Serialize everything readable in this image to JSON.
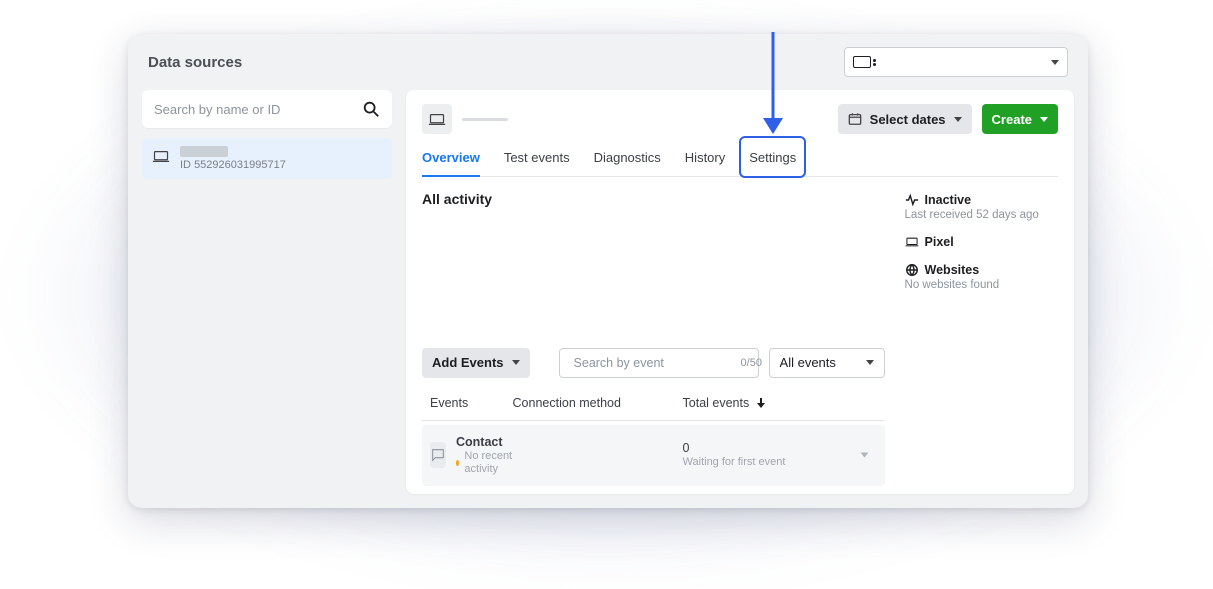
{
  "page": {
    "title": "Data sources"
  },
  "topbar": {
    "selected_account": ""
  },
  "sidebar": {
    "search_placeholder": "Search by name or ID",
    "items": [
      {
        "id_label": "ID",
        "id_value": "552926031995717"
      }
    ]
  },
  "main_header": {
    "select_dates_label": "Select dates",
    "create_label": "Create"
  },
  "tabs": [
    {
      "key": "overview",
      "label": "Overview",
      "active": true
    },
    {
      "key": "test_events",
      "label": "Test events",
      "active": false
    },
    {
      "key": "diagnostics",
      "label": "Diagnostics",
      "active": false
    },
    {
      "key": "history",
      "label": "History",
      "active": false
    },
    {
      "key": "settings",
      "label": "Settings",
      "active": false
    }
  ],
  "annotation": {
    "highlighted_tab": "settings"
  },
  "overview": {
    "heading": "All activity",
    "status": {
      "inactive_label": "Inactive",
      "last_received": "Last received 52 days ago",
      "pixel_label": "Pixel",
      "websites_label": "Websites",
      "websites_sub": "No websites found"
    },
    "events_toolbar": {
      "add_events_label": "Add Events",
      "search_placeholder": "Search by event",
      "counter": "0/50",
      "filter_label": "All events"
    },
    "columns": {
      "events": "Events",
      "connection_method": "Connection method",
      "total_events": "Total events"
    },
    "rows": [
      {
        "name": "Contact",
        "subtext": "No recent activity",
        "connection_method": "",
        "total_value": "0",
        "total_sub": "Waiting for first event"
      }
    ]
  }
}
